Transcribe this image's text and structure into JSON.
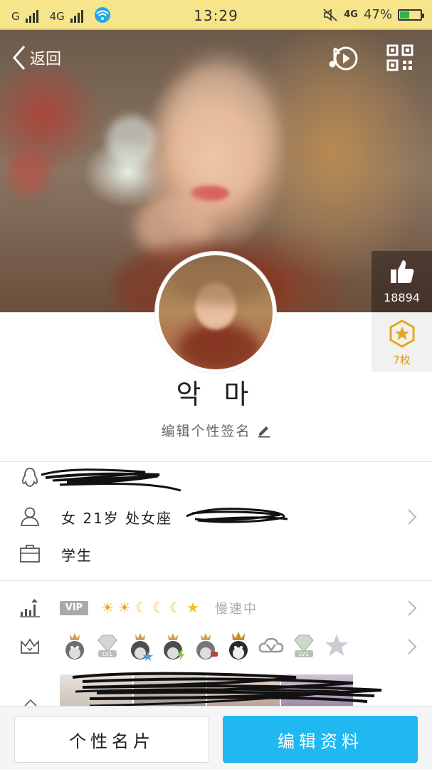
{
  "status_bar": {
    "carrier1": "G",
    "carrier2": "4G",
    "time": "13:29",
    "network": "4G",
    "battery": "47%",
    "battery_level": 0.47
  },
  "header": {
    "back_label": "返回"
  },
  "hero": {
    "likes": "18894",
    "medals": "7枚"
  },
  "profile": {
    "name": "악 마",
    "signature": "编辑个性签名"
  },
  "info": {
    "basic": "女  21岁  处女座",
    "occupation": "学生"
  },
  "level": {
    "vip": "VIP",
    "speed": "慢速中"
  },
  "badges": [
    {
      "label": ""
    },
    {
      "label": "LV1"
    },
    {
      "label": ""
    },
    {
      "label": ""
    },
    {
      "label": ""
    },
    {
      "label": ""
    },
    {
      "label": ""
    },
    {
      "label": "LV1"
    },
    {
      "label": ""
    }
  ],
  "bottom": {
    "card_button": "个性名片",
    "edit_button": "编辑资料"
  },
  "colors": {
    "accent": "#1fb8f0",
    "status_bar": "#f6e58a",
    "medal": "#d49a19"
  }
}
